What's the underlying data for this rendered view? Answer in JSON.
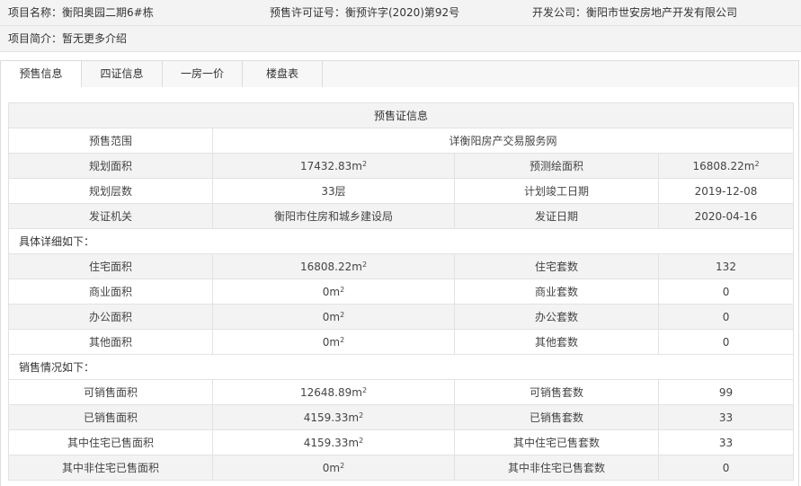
{
  "header": {
    "project_name": "项目名称：衡阳奥园二期6#栋",
    "presale_permit": "预售许可证号：衡预许字(2020)第92号",
    "developer": "开发公司：衡阳市世安房地产开发有限公司",
    "project_intro": "项目简介：暂无更多介绍"
  },
  "tabs": [
    {
      "label": "预售信息",
      "active": true
    },
    {
      "label": "四证信息",
      "active": false
    },
    {
      "label": "一房一价",
      "active": false
    },
    {
      "label": "楼盘表",
      "active": false
    }
  ],
  "table": {
    "title": "预售证信息",
    "scope": {
      "label": "预售范围",
      "value": "详衡阳房产交易服务网"
    },
    "basic": [
      {
        "l1": "规划面积",
        "v1": "17432.83",
        "u1": "m",
        "l2": "预测绘面积",
        "v2": "16808.22",
        "u2": "m"
      },
      {
        "l1": "规划层数",
        "v1": "33层",
        "u1": "",
        "l2": "计划竣工日期",
        "v2": "2019-12-08",
        "u2": ""
      },
      {
        "l1": "发证机关",
        "v1": "衡阳市住房和城乡建设局",
        "u1": "",
        "l2": "发证日期",
        "v2": "2020-04-16",
        "u2": ""
      }
    ],
    "detail_heading": "具体详细如下：",
    "detail": [
      {
        "l1": "住宅面积",
        "v1": "16808.22",
        "u1": "m",
        "l2": "住宅套数",
        "v2": "132"
      },
      {
        "l1": "商业面积",
        "v1": "0",
        "u1": "m",
        "l2": "商业套数",
        "v2": "0"
      },
      {
        "l1": "办公面积",
        "v1": "0",
        "u1": "m",
        "l2": "办公套数",
        "v2": "0"
      },
      {
        "l1": "其他面积",
        "v1": "0",
        "u1": "m",
        "l2": "其他套数",
        "v2": "0"
      }
    ],
    "sales_heading": "销售情况如下：",
    "sales": [
      {
        "l1": "可销售面积",
        "v1": "12648.89",
        "u1": "m",
        "l2": "可销售套数",
        "v2": "99"
      },
      {
        "l1": "已销售面积",
        "v1": "4159.33",
        "u1": "m",
        "l2": "已销售套数",
        "v2": "33"
      },
      {
        "l1": "其中住宅已售面积",
        "v1": "4159.33",
        "u1": "m",
        "l2": "其中住宅已售套数",
        "v2": "33"
      },
      {
        "l1": "其中非住宅已售面积",
        "v1": "0",
        "u1": "m",
        "l2": "其中非住宅已售套数",
        "v2": "0"
      }
    ],
    "unit_superscript": "2"
  }
}
